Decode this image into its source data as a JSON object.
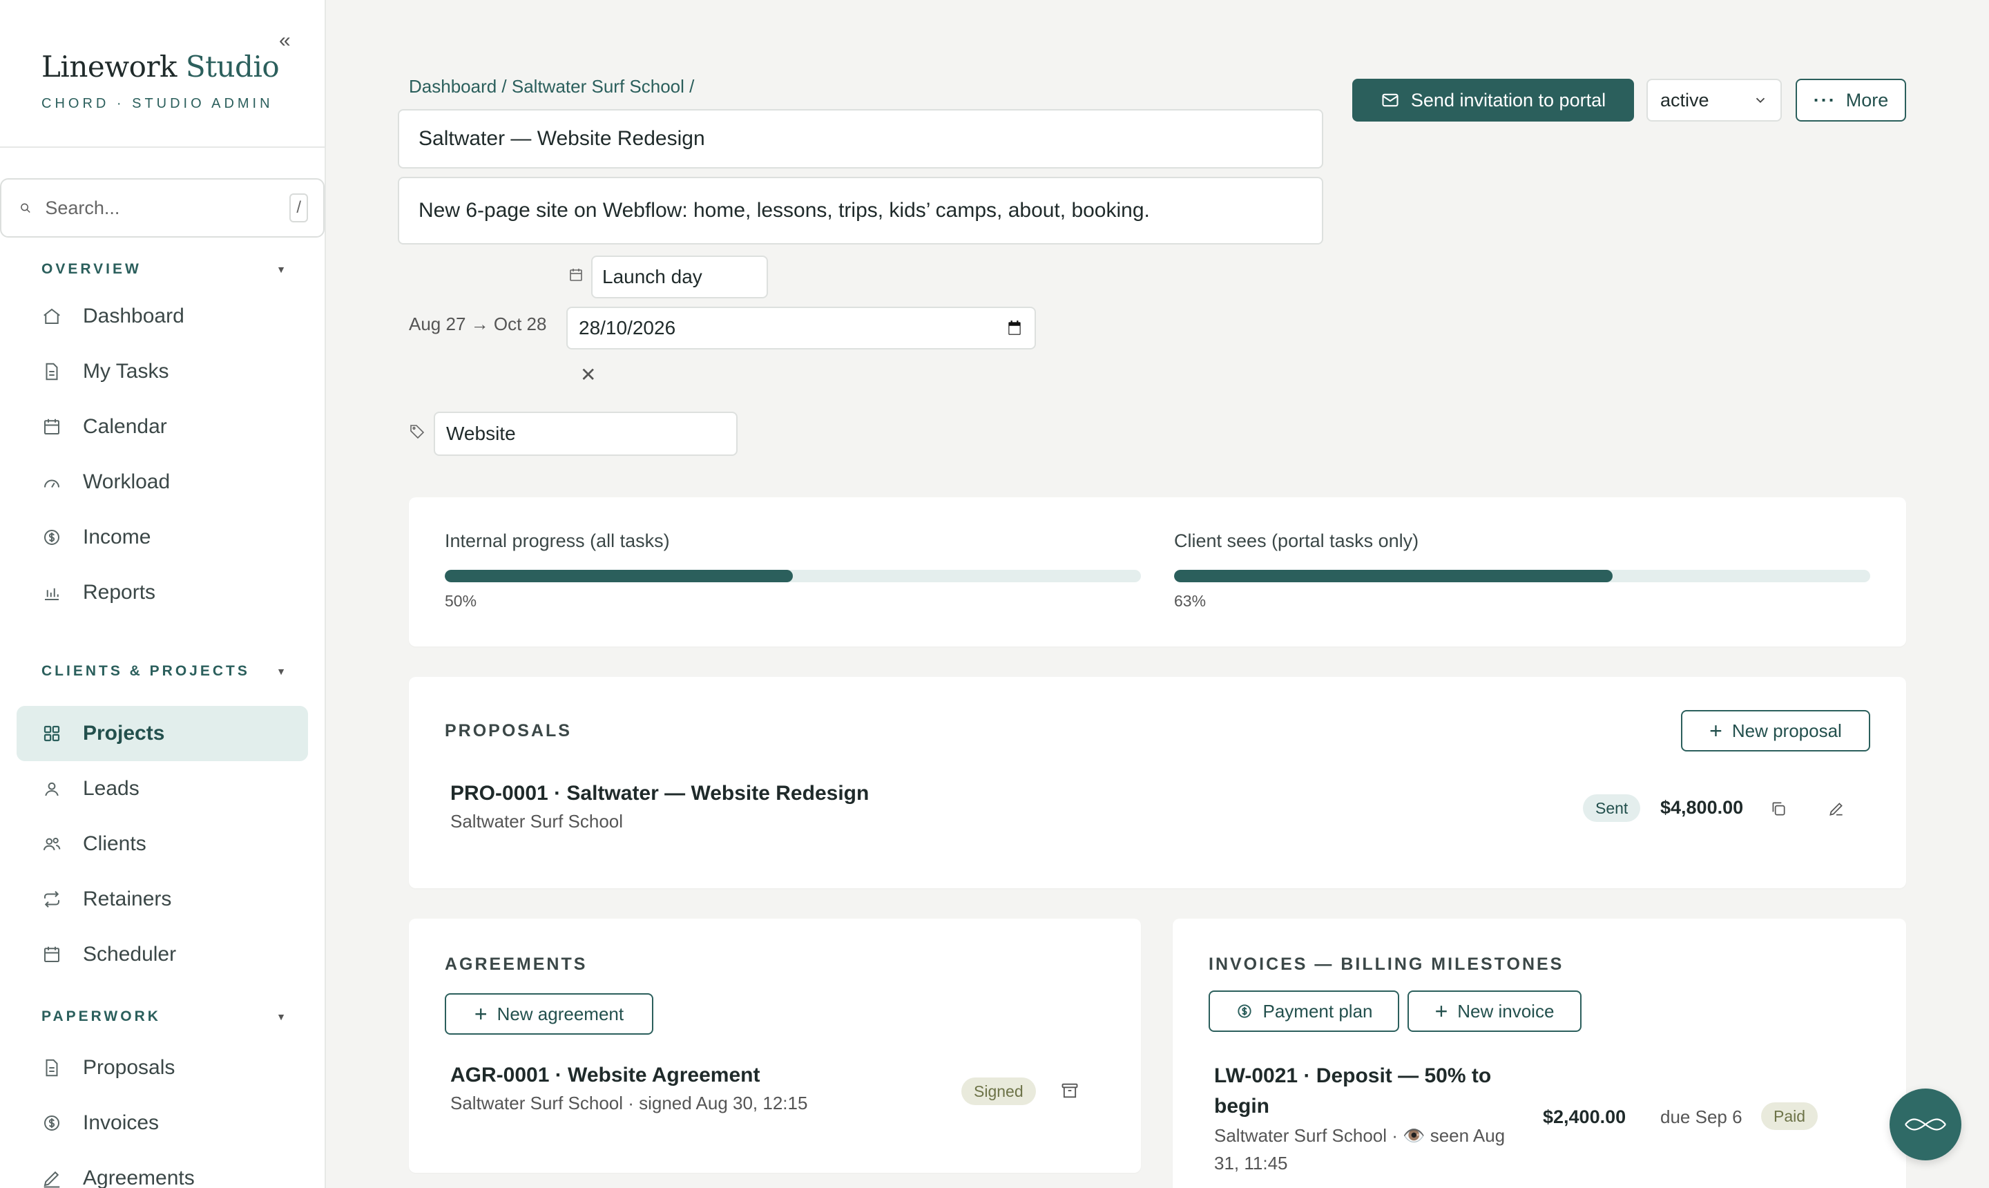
{
  "brand": {
    "name_main": "Linework",
    "name_accent": "Studio",
    "subtitle": "CHORD · STUDIO ADMIN",
    "collapse_glyph": "«"
  },
  "search": {
    "placeholder": "Search...",
    "shortcut": "/"
  },
  "sidebar": {
    "sections": [
      {
        "title": "OVERVIEW",
        "items": [
          {
            "label": "Dashboard",
            "icon": "home-icon"
          },
          {
            "label": "My Tasks",
            "icon": "document-icon"
          },
          {
            "label": "Calendar",
            "icon": "calendar-icon"
          },
          {
            "label": "Workload",
            "icon": "gauge-icon"
          },
          {
            "label": "Income",
            "icon": "dollar-icon"
          },
          {
            "label": "Reports",
            "icon": "bar-chart-icon"
          }
        ]
      },
      {
        "title": "CLIENTS & PROJECTS",
        "items": [
          {
            "label": "Projects",
            "icon": "grid-icon",
            "active": true
          },
          {
            "label": "Leads",
            "icon": "user-icon"
          },
          {
            "label": "Clients",
            "icon": "users-icon"
          },
          {
            "label": "Retainers",
            "icon": "repeat-icon"
          },
          {
            "label": "Scheduler",
            "icon": "calendar-icon"
          }
        ]
      },
      {
        "title": "PAPERWORK",
        "items": [
          {
            "label": "Proposals",
            "icon": "document-icon"
          },
          {
            "label": "Invoices",
            "icon": "dollar-icon"
          },
          {
            "label": "Agreements",
            "icon": "pen-icon"
          }
        ]
      }
    ]
  },
  "breadcrumb": {
    "dashboard": "Dashboard",
    "sep1": " / ",
    "client": "Saltwater Surf School",
    "sep2": " /"
  },
  "project": {
    "title": "Saltwater — Website Redesign",
    "description": "New 6-page site on Webflow: home, lessons, trips, kids’ camps, about, booking.",
    "milestone_label": "Launch day",
    "date_range": "Aug 27 → Oct 28",
    "date_value": "28/10/2026",
    "tag": "Website"
  },
  "actions": {
    "send_invitation": "Send invitation to portal",
    "status": "active",
    "more": "More"
  },
  "progress": {
    "internal_label": "Internal progress (all tasks)",
    "internal_value": 50,
    "internal_pct": "50%",
    "client_label": "Client sees (portal tasks only)",
    "client_value": 63,
    "client_pct": "63%"
  },
  "proposals": {
    "title": "PROPOSALS",
    "new_button": "New proposal",
    "items": [
      {
        "title": "PRO-0001 · Saltwater — Website Redesign",
        "subtitle": "Saltwater Surf School",
        "status": "Sent",
        "amount": "$4,800.00"
      }
    ]
  },
  "agreements": {
    "title": "AGREEMENTS",
    "new_button": "New agreement",
    "items": [
      {
        "title": "AGR-0001 · Website Agreement",
        "subtitle": "Saltwater Surf School · signed Aug 30, 12:15",
        "status": "Signed"
      }
    ]
  },
  "invoices": {
    "title": "INVOICES — BILLING MILESTONES",
    "payment_plan_button": "Payment plan",
    "new_button": "New invoice",
    "items": [
      {
        "title_line1": "LW-0021 · Deposit — 50% to",
        "title_line2": "begin",
        "subtitle_line1": "Saltwater Surf School · 👁️ seen Aug",
        "subtitle_line2": "31, 11:45",
        "amount": "$2,400.00",
        "due": "due Sep 6",
        "status": "Paid"
      }
    ]
  },
  "colors": {
    "accent": "#2b5f5c",
    "active_bg": "#e2eeec",
    "progress_track": "#e4eeed",
    "badge_paid_bg": "#e9eadc"
  }
}
